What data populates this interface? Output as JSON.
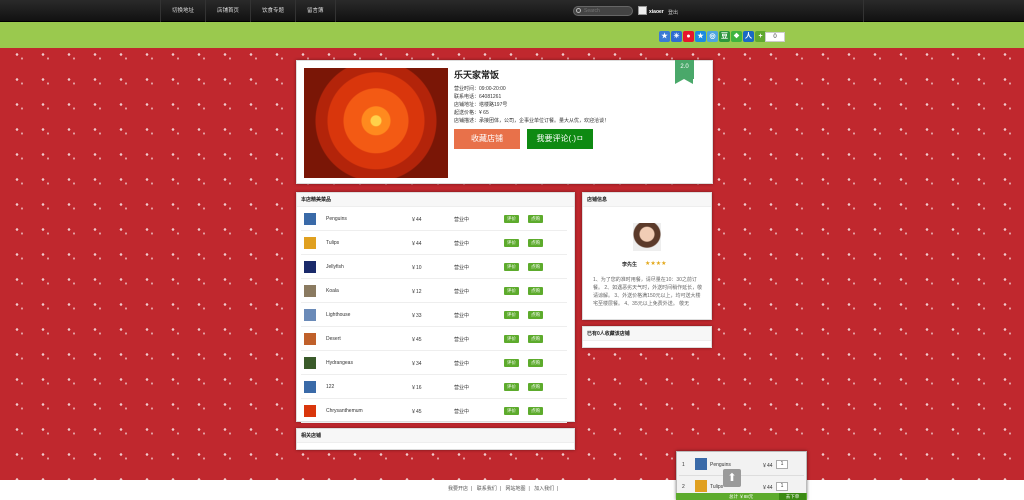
{
  "nav": {
    "items": [
      "切换地址",
      "店铺首页",
      "饮食专题",
      "留言簿"
    ],
    "search_placeholder": "Search",
    "user": "xiaoer",
    "logout": "登出"
  },
  "share": {
    "icons": [
      {
        "name": "favorite-share-icon",
        "color": "#3a7bd5",
        "glyph": "★"
      },
      {
        "name": "baidu-share-icon",
        "color": "#2f6bd0",
        "glyph": "☀"
      },
      {
        "name": "weibo-share-icon",
        "color": "#e6162d",
        "glyph": "●"
      },
      {
        "name": "qzone-share-icon",
        "color": "#1b8be0",
        "glyph": "★"
      },
      {
        "name": "qq-weibo-share-icon",
        "color": "#4ea5e0",
        "glyph": "◎"
      },
      {
        "name": "douban-share-icon",
        "color": "#2d963d",
        "glyph": "豆"
      },
      {
        "name": "wechat-share-icon",
        "color": "#3fb43f",
        "glyph": "❖"
      },
      {
        "name": "renren-share-icon",
        "color": "#1a69c4",
        "glyph": "人"
      },
      {
        "name": "more-share-icon",
        "color": "#60a830",
        "glyph": "+"
      }
    ],
    "count": "0"
  },
  "shop": {
    "title": "乐天家常饭",
    "rating": "2.0",
    "hours": "营业时间：09:00-20:00",
    "phone": "联系电话：64081261",
    "address": "店铺地址：塔楼路197号",
    "min_order": "起送价格：¥ 65",
    "desc": "店铺描述：承接团体，公司，企事业单位订餐。量大从优，欢迎洽谈！",
    "fav_button": "收藏店铺",
    "review_button": "我要评论(.)ㅁ"
  },
  "menu": {
    "heading": "本店精美菜品",
    "rate_label": "评价",
    "order_label": "点购",
    "dishes": [
      {
        "name": "Penguins",
        "price": "￥44",
        "status": "营业中",
        "color": "#3a6aa8"
      },
      {
        "name": "Tulips",
        "price": "￥44",
        "status": "营业中",
        "color": "#e0a020"
      },
      {
        "name": "Jellyfish",
        "price": "￥10",
        "status": "营业中",
        "color": "#1a2a6a"
      },
      {
        "name": "Koala",
        "price": "￥12",
        "status": "营业中",
        "color": "#8a7a60"
      },
      {
        "name": "Lighthouse",
        "price": "￥33",
        "status": "营业中",
        "color": "#6a8ab8"
      },
      {
        "name": "Desert",
        "price": "￥45",
        "status": "营业中",
        "color": "#c0602a"
      },
      {
        "name": "Hydrangeas",
        "price": "￥34",
        "status": "营业中",
        "color": "#3a5a2a"
      },
      {
        "name": "122",
        "price": "￥16",
        "status": "营业中",
        "color": "#3a6aa8"
      },
      {
        "name": "Chrysanthemum",
        "price": "￥45",
        "status": "营业中",
        "color": "#d9360c"
      }
    ]
  },
  "related": {
    "heading": "相关店铺"
  },
  "info": {
    "heading": "店铺信息",
    "owner": "李先生",
    "stars": "★★★★",
    "notice": "1、为了您的准时用餐，请尽量在10：30之前订餐。 2、如遇恶劣天气时，外送时间稍作延长，敬请谅解。 3、外送价格满150元以上，均可送大楼宅至楼层餐。 4、35元以上免费外送。 敬无"
  },
  "collect": {
    "heading": "已有0人收藏该店铺"
  },
  "footer": {
    "links": [
      "我要开店",
      "联系我们",
      "网站地图",
      "加入我们"
    ]
  },
  "cart": {
    "items": [
      {
        "num": "1",
        "name": "Penguins",
        "price": "￥44",
        "qty": "1"
      },
      {
        "num": "2",
        "name": "Tulips",
        "price": "￥44",
        "qty": "1"
      }
    ],
    "total": "总计 ￥88元",
    "order_button": "去下单"
  }
}
